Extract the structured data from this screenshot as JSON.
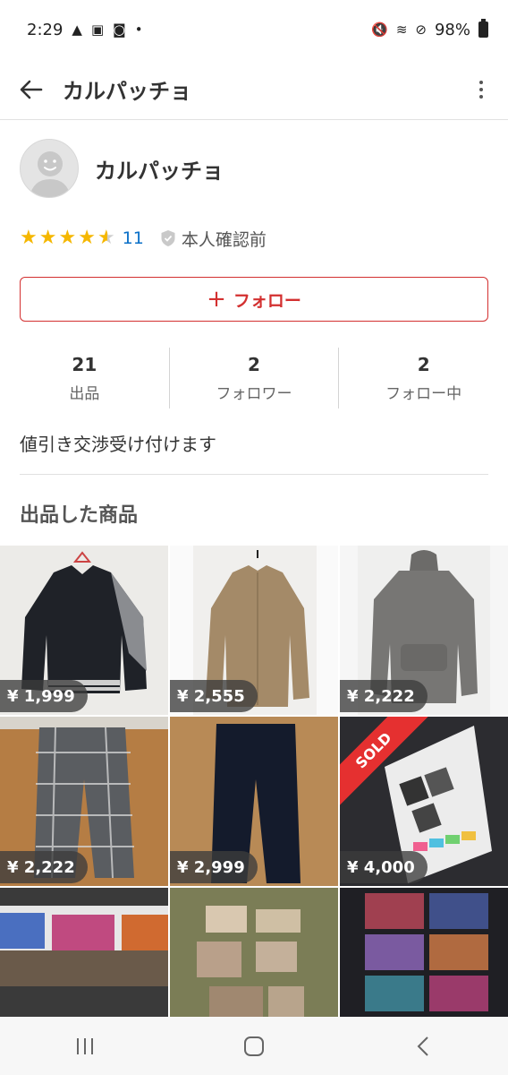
{
  "status_bar": {
    "time": "2:29",
    "battery": "98%"
  },
  "app_bar": {
    "title": "カルパッチョ"
  },
  "profile": {
    "name": "カルパッチョ",
    "rating_count": "11",
    "verification": "本人確認前"
  },
  "follow_button": {
    "label": "フォロー"
  },
  "stats": [
    {
      "value": "21",
      "label": "出品"
    },
    {
      "value": "2",
      "label": "フォロワー"
    },
    {
      "value": "2",
      "label": "フォロー中"
    }
  ],
  "bio": "値引き交渉受け付けます",
  "section_title": "出品した商品",
  "items": [
    {
      "price": "¥ 1,999",
      "sold": false
    },
    {
      "price": "¥ 2,555",
      "sold": false
    },
    {
      "price": "¥ 2,222",
      "sold": false
    },
    {
      "price": "¥ 2,222",
      "sold": false
    },
    {
      "price": "¥ 2,999",
      "sold": false
    },
    {
      "price": "¥ 4,000",
      "sold": true,
      "badge": "SOLD"
    },
    {
      "price": "",
      "sold": false
    },
    {
      "price": "",
      "sold": false
    },
    {
      "price": "",
      "sold": false
    }
  ],
  "colors": {
    "accent": "#d33030",
    "link": "#0b70c8",
    "star": "#f5b700"
  }
}
